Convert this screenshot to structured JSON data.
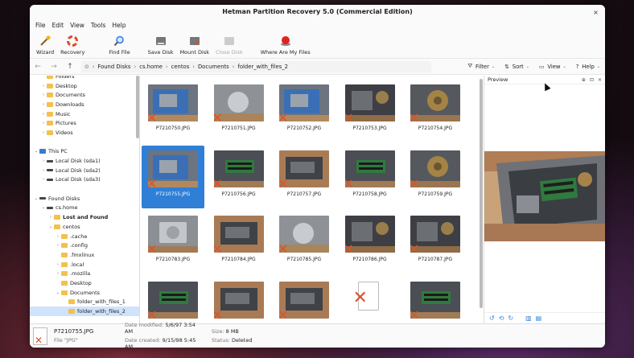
{
  "window": {
    "title": "Hetman Partition Recovery 5.0 (Commercial Edition)",
    "close_glyph": "×"
  },
  "menu": [
    "File",
    "Edit",
    "View",
    "Tools",
    "Help"
  ],
  "toolbar": [
    {
      "label": "Wizard",
      "icon": "wizard-icon",
      "enabled": true
    },
    {
      "label": "Recovery",
      "icon": "lifebuoy-icon",
      "enabled": true
    },
    {
      "label": "Find File",
      "icon": "magnifier-icon",
      "enabled": true
    },
    {
      "label": "Save Disk",
      "icon": "disk-save-icon",
      "enabled": true
    },
    {
      "label": "Mount Disk",
      "icon": "disk-mount-icon",
      "enabled": true
    },
    {
      "label": "Close Disk",
      "icon": "disk-close-icon",
      "enabled": false
    },
    {
      "label": "Where Are My Files",
      "icon": "red-button-icon",
      "enabled": true
    }
  ],
  "nav": {
    "back": "←",
    "forward": "→",
    "up": "↑"
  },
  "breadcrumb": [
    "Found Disks",
    "cs.home",
    "centos",
    "Documents",
    "folder_with_files_2"
  ],
  "right_tools": [
    {
      "label": "Filter",
      "icon": "funnel-icon",
      "glyph": "⛛"
    },
    {
      "label": "Sort",
      "icon": "sort-icon",
      "glyph": "⇅"
    },
    {
      "label": "View",
      "icon": "view-icon",
      "glyph": "▭"
    },
    {
      "label": "Help",
      "icon": "help-icon",
      "glyph": "?"
    }
  ],
  "tree": [
    {
      "label": "Folders",
      "level": 1,
      "arrow": "",
      "type": "folder"
    },
    {
      "label": "Desktop",
      "level": 1,
      "arrow": "›",
      "type": "folder"
    },
    {
      "label": "Documents",
      "level": 1,
      "arrow": "›",
      "type": "folder"
    },
    {
      "label": "Downloads",
      "level": 1,
      "arrow": "›",
      "type": "folder"
    },
    {
      "label": "Music",
      "level": 1,
      "arrow": "›",
      "type": "folder"
    },
    {
      "label": "Pictures",
      "level": 1,
      "arrow": "›",
      "type": "folder"
    },
    {
      "label": "Videos",
      "level": 1,
      "arrow": "›",
      "type": "folder"
    },
    {
      "label": "",
      "level": 0,
      "arrow": "",
      "type": "blank"
    },
    {
      "label": "This PC",
      "level": 0,
      "arrow": "⌄",
      "type": "pc"
    },
    {
      "label": "Local Disk (sda1)",
      "level": 1,
      "arrow": "›",
      "type": "disk"
    },
    {
      "label": "Local Disk (sda2)",
      "level": 1,
      "arrow": "›",
      "type": "disk"
    },
    {
      "label": "Local Disk (sda3)",
      "level": 1,
      "arrow": "›",
      "type": "disk"
    },
    {
      "label": "",
      "level": 0,
      "arrow": "",
      "type": "blank"
    },
    {
      "label": "Found Disks",
      "level": 0,
      "arrow": "⌄",
      "type": "disk"
    },
    {
      "label": "cs.home",
      "level": 1,
      "arrow": "⌄",
      "type": "disk"
    },
    {
      "label": "Lost and Found",
      "level": 2,
      "arrow": "›",
      "type": "folder",
      "bold": true
    },
    {
      "label": "centos",
      "level": 2,
      "arrow": "⌄",
      "type": "folder"
    },
    {
      "label": ".cache",
      "level": 3,
      "arrow": "›",
      "type": "folder"
    },
    {
      "label": ".config",
      "level": 3,
      "arrow": "›",
      "type": "folder"
    },
    {
      "label": ".fmxlinux",
      "level": 3,
      "arrow": "",
      "type": "folder"
    },
    {
      "label": ".local",
      "level": 3,
      "arrow": "›",
      "type": "folder"
    },
    {
      "label": ".mozilla",
      "level": 3,
      "arrow": "›",
      "type": "folder"
    },
    {
      "label": "Desktop",
      "level": 3,
      "arrow": "",
      "type": "folder"
    },
    {
      "label": "Documents",
      "level": 3,
      "arrow": "⌄",
      "type": "folder"
    },
    {
      "label": "folder_with_files_1",
      "level": 4,
      "arrow": "",
      "type": "folder"
    },
    {
      "label": "folder_with_files_2",
      "level": 4,
      "arrow": "",
      "type": "folder",
      "selected": true
    }
  ],
  "files": [
    {
      "name": "P7210750.JPG",
      "tone": "blue"
    },
    {
      "name": "P7210751.JPG",
      "tone": "grey"
    },
    {
      "name": "P7210752.JPG",
      "tone": "blue"
    },
    {
      "name": "P7210753.JPG",
      "tone": "dark"
    },
    {
      "name": "P7210754.JPG",
      "tone": "fan"
    },
    {
      "name": "P7210755.JPG",
      "tone": "blue",
      "selected": true
    },
    {
      "name": "P7210756.JPG",
      "tone": "green"
    },
    {
      "name": "P7210757.JPG",
      "tone": "wood"
    },
    {
      "name": "P7210758.JPG",
      "tone": "green"
    },
    {
      "name": "P7210759.JPG",
      "tone": "fan"
    },
    {
      "name": "P7210783.JPG",
      "tone": "hdd"
    },
    {
      "name": "P7210784.JPG",
      "tone": "wood"
    },
    {
      "name": "P7210785.JPG",
      "tone": "grey"
    },
    {
      "name": "P7210786.JPG",
      "tone": "dark"
    },
    {
      "name": "P7210787.JPG",
      "tone": "dark"
    },
    {
      "name": "",
      "tone": "green"
    },
    {
      "name": "",
      "tone": "wood"
    },
    {
      "name": "",
      "tone": "wood"
    },
    {
      "name": "",
      "tone": "doc"
    },
    {
      "name": "",
      "tone": "green"
    }
  ],
  "preview": {
    "title": "Preview",
    "icons": [
      "⊕",
      "⊡",
      "×"
    ],
    "footer": [
      "↺",
      "⟲",
      "↻",
      "▥",
      "▤"
    ]
  },
  "status": {
    "name": "P7210755.JPG",
    "type": "File \"JPG\"",
    "modified_label": "Date modified:",
    "modified": "5/6/97 3:54 AM",
    "created_label": "Date created:",
    "created": "9/15/98 5:45 AM",
    "size_label": "Size:",
    "size": "8 MB",
    "state_label": "Status:",
    "state": "Deleted"
  }
}
